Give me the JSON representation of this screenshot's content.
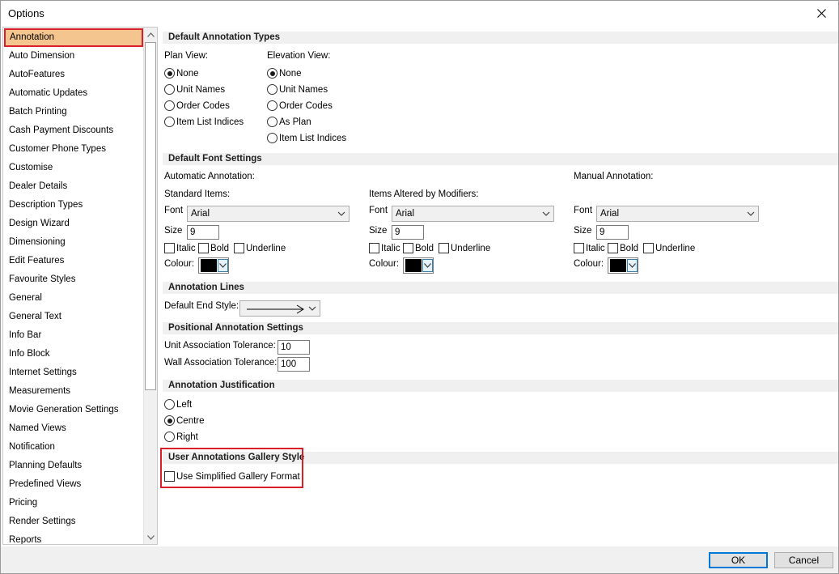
{
  "window": {
    "title": "Options"
  },
  "sidebar": {
    "items": [
      "Annotation",
      "Auto Dimension",
      "AutoFeatures",
      "Automatic Updates",
      "Batch Printing",
      "Cash Payment Discounts",
      "Customer Phone Types",
      "Customise",
      "Dealer Details",
      "Description Types",
      "Design Wizard",
      "Dimensioning",
      "Edit Features",
      "Favourite Styles",
      "General",
      "General Text",
      "Info Bar",
      "Info Block",
      "Internet Settings",
      "Measurements",
      "Movie Generation Settings",
      "Named Views",
      "Notification",
      "Planning Defaults",
      "Predefined Views",
      "Pricing",
      "Render Settings",
      "Reports"
    ],
    "selected": "Annotation"
  },
  "annotation_types": {
    "header": "Default Annotation Types",
    "plan_label": "Plan View:",
    "plan_options": [
      "None",
      "Unit Names",
      "Order Codes",
      "Item List Indices"
    ],
    "plan_selected": "None",
    "elev_label": "Elevation View:",
    "elev_options": [
      "None",
      "Unit Names",
      "Order Codes",
      "As Plan",
      "Item List Indices"
    ],
    "elev_selected": "None"
  },
  "font_settings": {
    "header": "Default Font Settings",
    "automatic_label": "Automatic Annotation:",
    "manual_label": "Manual Annotation:",
    "standard_label": "Standard Items:",
    "altered_label": "Items Altered by Modifiers:",
    "font_label": "Font",
    "size_label": "Size",
    "colour_label": "Colour:",
    "italic": "Italic",
    "bold": "Bold",
    "underline": "Underline",
    "standard": {
      "font": "Arial",
      "size": "9",
      "colour": "#000000"
    },
    "altered": {
      "font": "Arial",
      "size": "9",
      "colour": "#000000"
    },
    "manual": {
      "font": "Arial",
      "size": "9",
      "colour": "#000000"
    }
  },
  "annotation_lines": {
    "header": "Annotation Lines",
    "end_style_label": "Default End Style:"
  },
  "positional": {
    "header": "Positional Annotation Settings",
    "unit_label": "Unit Association Tolerance:",
    "unit_value": "10",
    "wall_label": "Wall Association Tolerance:",
    "wall_value": "100"
  },
  "justification": {
    "header": "Annotation Justification",
    "options": [
      "Left",
      "Centre",
      "Right"
    ],
    "selected": "Centre"
  },
  "gallery": {
    "header": "User Annotations Gallery Style",
    "checkbox_label": "Use Simplified Gallery Format",
    "checked": false
  },
  "footer": {
    "ok": "OK",
    "cancel": "Cancel"
  },
  "colors": {
    "selected_bg": "#f4c58e",
    "highlight": "#d9202a",
    "accent": "#0078d7"
  }
}
